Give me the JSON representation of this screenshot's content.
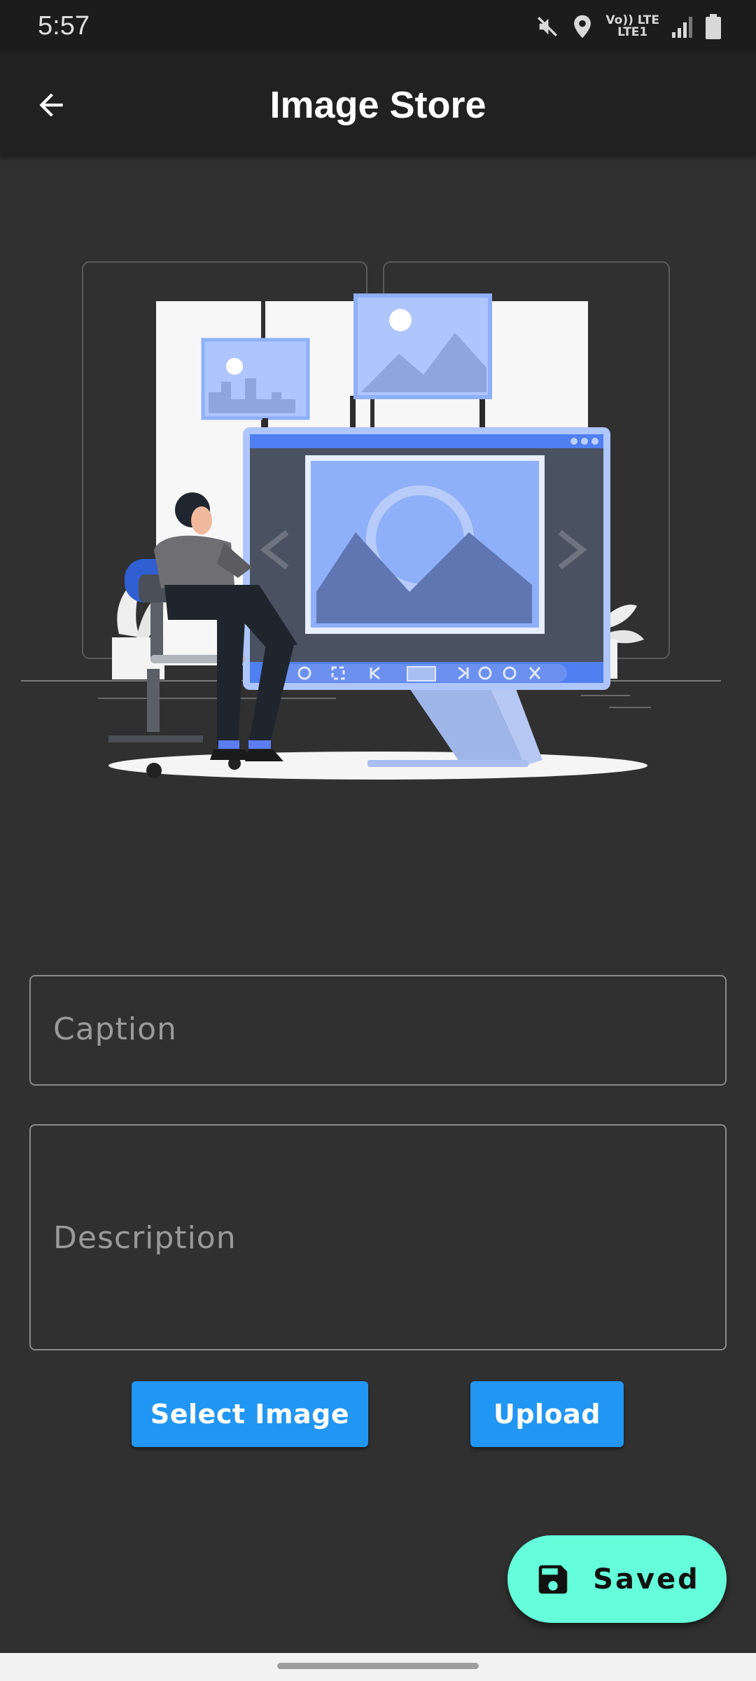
{
  "status_bar": {
    "time": "5:57",
    "lte_top": "Vo)) LTE",
    "lte_bottom": "LTE1",
    "icons": [
      "mute-icon",
      "location-icon",
      "volte-lte-icon",
      "signal-icon",
      "battery-icon"
    ]
  },
  "app_bar": {
    "title": "Image Store",
    "back_icon": "arrow-back-icon"
  },
  "form": {
    "caption_placeholder": "Caption",
    "description_placeholder": "Description"
  },
  "buttons": {
    "select_image": "Select Image",
    "upload": "Upload"
  },
  "fab": {
    "label": "Saved",
    "icon": "save-icon"
  },
  "colors": {
    "background": "#303030",
    "app_bar": "#212121",
    "primary_button": "#2196f3",
    "fab": "#64ffda",
    "illustration_accent": "#8fb0f8"
  }
}
